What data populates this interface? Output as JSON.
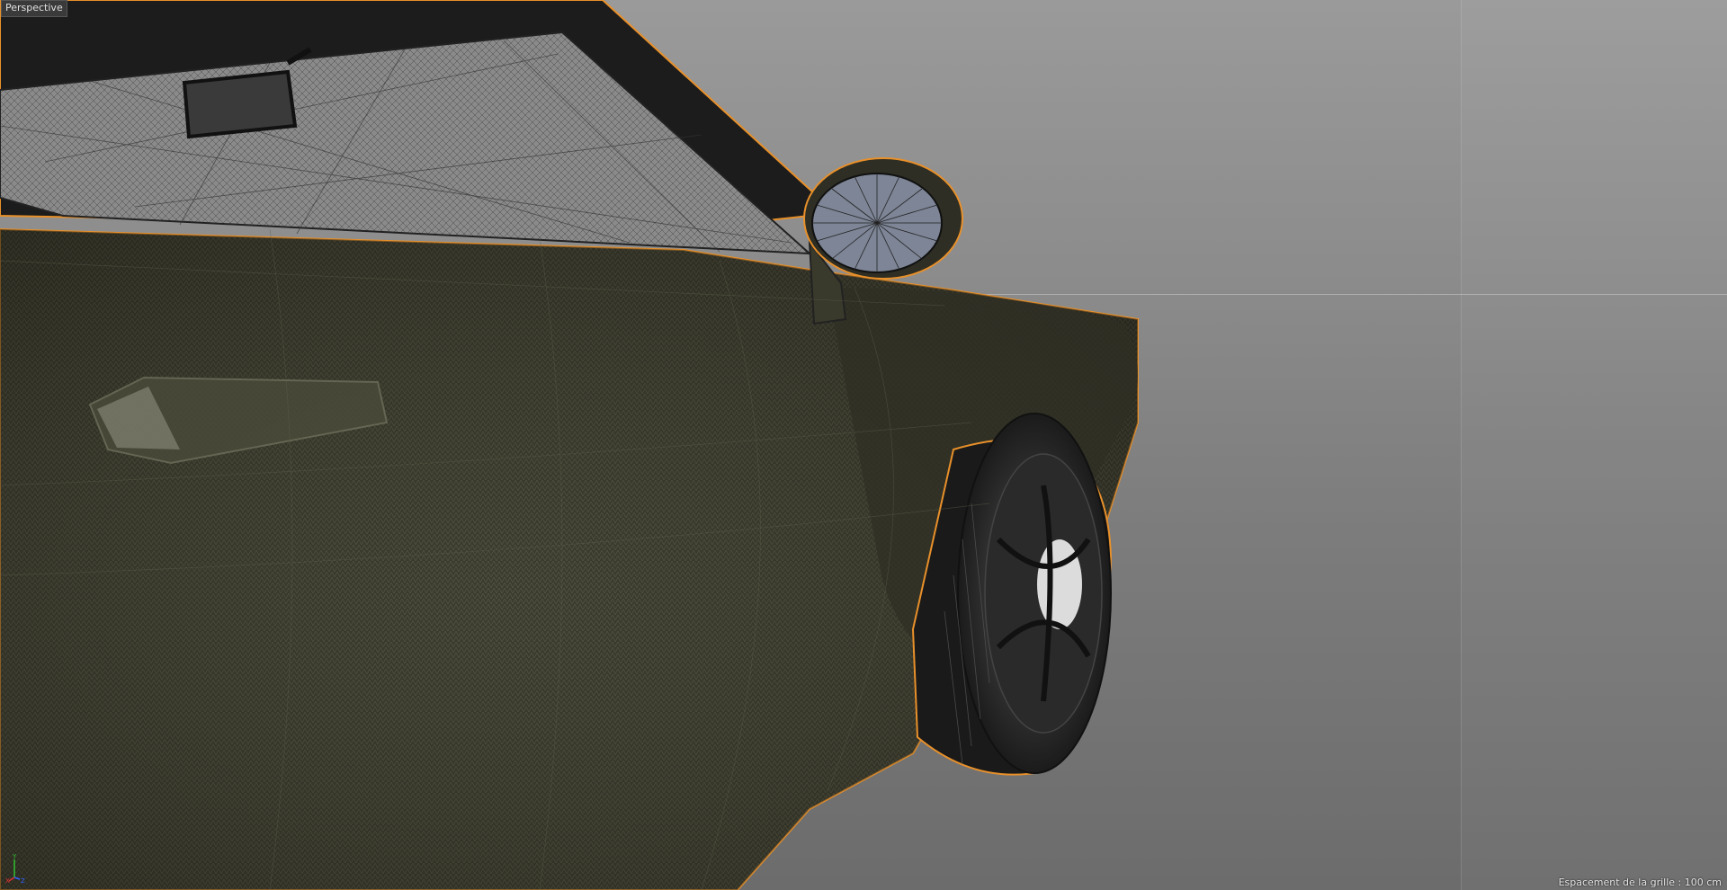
{
  "viewport": {
    "view_name": "Perspective",
    "grid_spacing_text": "Espacement de la grille : 100 cm"
  },
  "axis_gizmo": {
    "labels": {
      "x": "X",
      "y": "Y",
      "z": "Z"
    },
    "colors": {
      "x": "#e03030",
      "y": "#30c030",
      "z": "#3060ff"
    }
  },
  "colors": {
    "selection_outline": "#e8902a",
    "background_top": "#9a9a9a",
    "background_bottom": "#6c6c6c",
    "body_paint": "#3b3a2c"
  }
}
